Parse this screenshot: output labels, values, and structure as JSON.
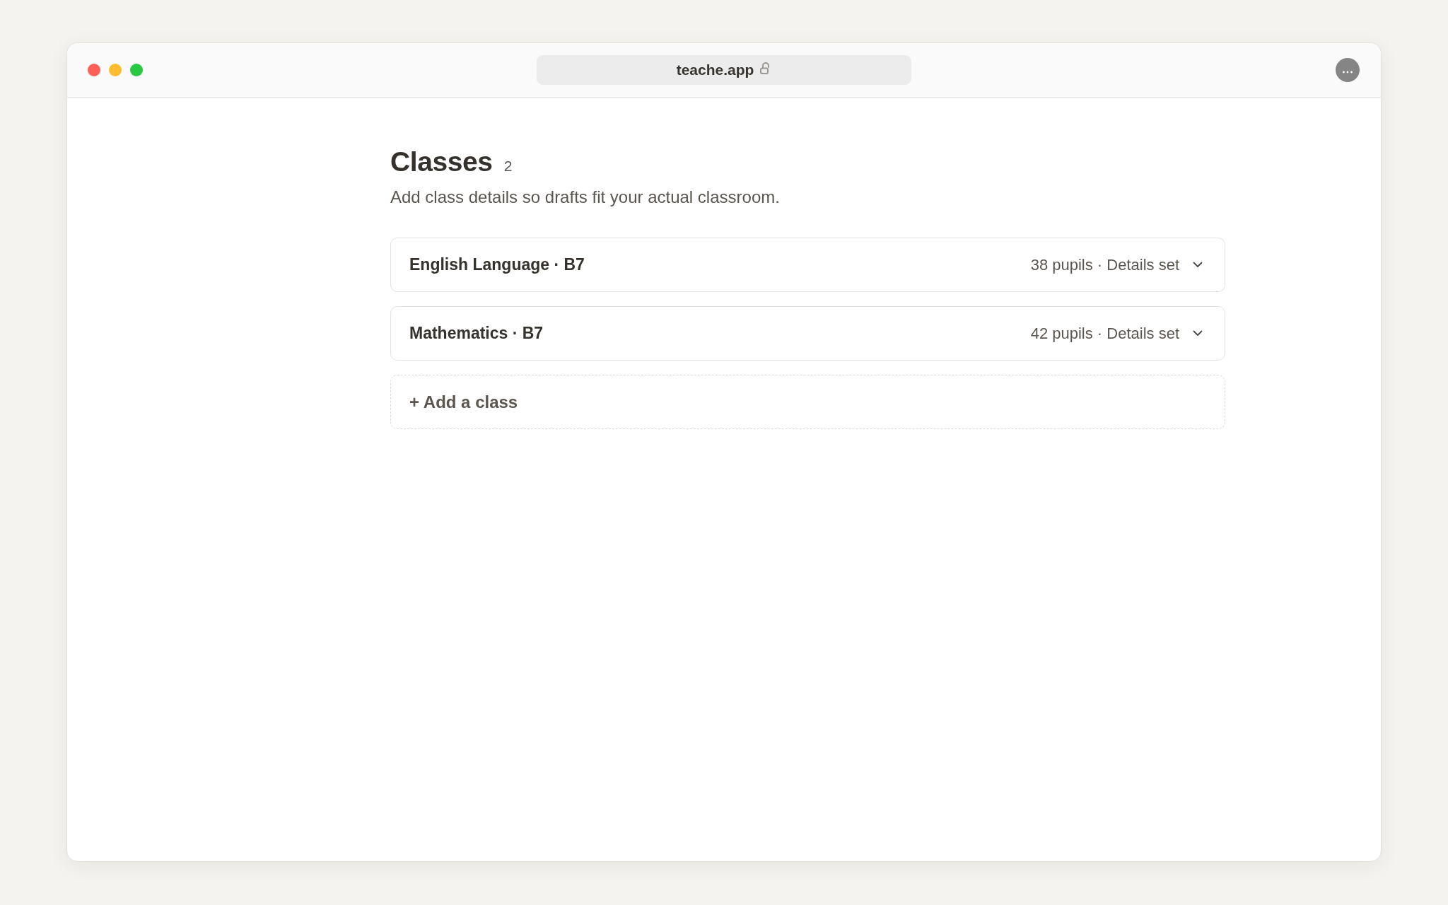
{
  "browser": {
    "address": "teache.app"
  },
  "page": {
    "title": "Classes",
    "count": "2",
    "subtitle": "Add class details so drafts fit your actual classroom."
  },
  "classes": [
    {
      "name": "English Language · B7",
      "summary": "38 pupils · Details set",
      "expanded": false
    },
    {
      "name": "Mathematics · B7",
      "summary": "42 pupils · Details set",
      "expanded": false
    }
  ],
  "add_button": {
    "label": "+ Add a class"
  }
}
